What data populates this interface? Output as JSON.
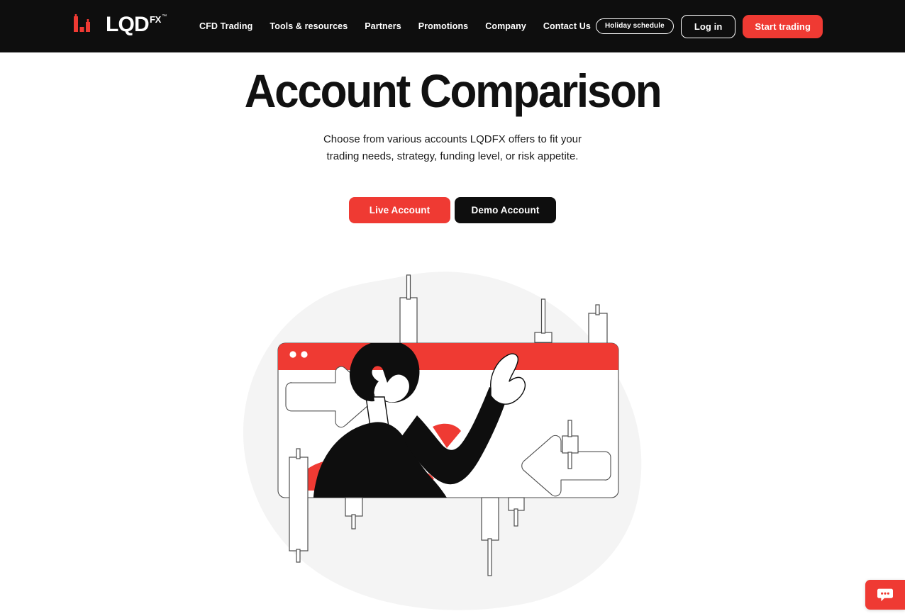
{
  "header": {
    "logo": {
      "mark_icon": "candlestick-logo-mark",
      "word": "LQD",
      "superscript": "FX",
      "trademark": "™"
    },
    "nav": [
      {
        "label": "CFD Trading"
      },
      {
        "label": "Tools & resources"
      },
      {
        "label": "Partners"
      },
      {
        "label": "Promotions"
      },
      {
        "label": "Company"
      },
      {
        "label": "Contact Us"
      }
    ],
    "holiday_pill_label": "Holiday schedule",
    "login_label": "Log in",
    "start_trading_label": "Start trading"
  },
  "hero": {
    "title": "Account Comparison",
    "subtitle": "Choose from various accounts LQDFX offers to fit your trading needs, strategy, funding level, or risk appetite.",
    "live_account_label": "Live Account",
    "demo_account_label": "Demo Account"
  },
  "illustration": {
    "name": "trader-browser-candlesticks-illustration",
    "browser_window": {
      "titlebar_color": "#ef3a33",
      "dots": 2
    },
    "blob_color": "#f4f4f4",
    "stroke_color": "#4d4d4d",
    "accent_color": "#ef3a33",
    "figure_color": "#0e0e0e"
  },
  "chat": {
    "icon": "chat-bubble-icon",
    "color": "#ef3a33"
  },
  "colors": {
    "brand_red": "#ef3a33",
    "header_black": "#0e0e0e",
    "text_dark": "#111111",
    "white": "#ffffff",
    "blob_gray": "#f4f4f4",
    "outline_gray": "#4d4d4d"
  }
}
